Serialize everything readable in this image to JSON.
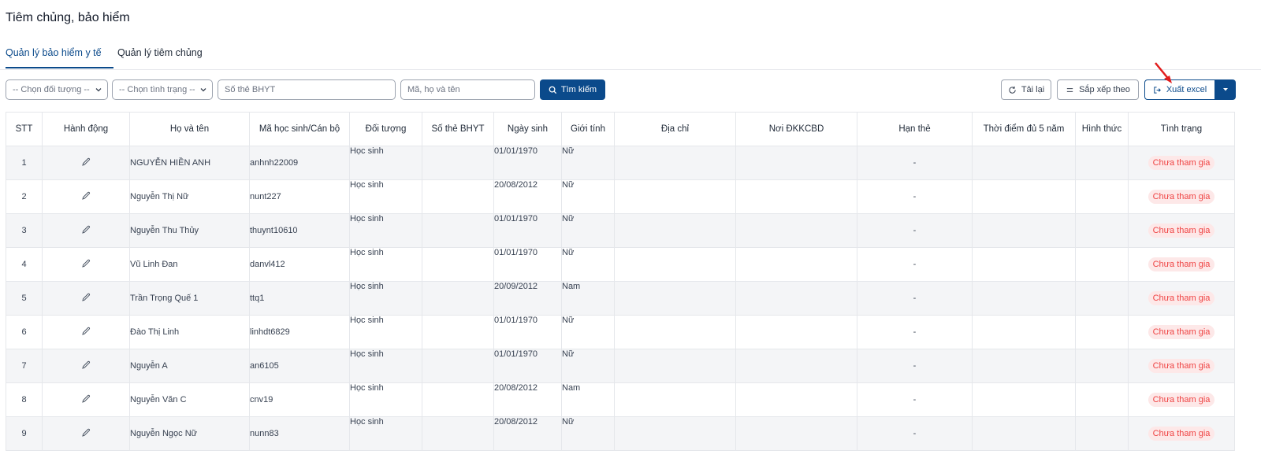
{
  "page": {
    "title": "Tiêm chủng, bảo hiểm"
  },
  "tabs": [
    {
      "label": "Quản lý bảo hiểm y tế",
      "active": true
    },
    {
      "label": "Quản lý tiêm chủng",
      "active": false
    }
  ],
  "filters": {
    "subject_select": "-- Chọn đối tượng --",
    "status_select": "-- Chọn tình trạng --",
    "card_placeholder": "Số thẻ BHYT",
    "name_placeholder": "Mã, họ và tên",
    "search_label": "Tìm kiếm"
  },
  "toolbar": {
    "reload_label": "Tải lại",
    "sort_label": "Sắp xếp theo",
    "export_label": "Xuất excel"
  },
  "colors": {
    "primary": "#0b4a8b",
    "status_text": "#ef4444",
    "status_bg": "#fde8e8",
    "arrow": "#e11d1d"
  },
  "table": {
    "headers": [
      "STT",
      "Hành động",
      "Họ và tên",
      "Mã học sinh/Cán bộ",
      "Đối tượng",
      "Số thẻ BHYT",
      "Ngày sinh",
      "Giới tính",
      "Địa chỉ",
      "Nơi ĐKKCBD",
      "Hạn thẻ",
      "Thời điểm đủ 5 năm",
      "Hình thức",
      "Tình trạng"
    ],
    "rows": [
      {
        "stt": "1",
        "name": "NGUYỄN HIỀN ANH",
        "code": "anhnh22009",
        "subject": "Học sinh",
        "card": "",
        "dob": "01/01/1970",
        "gender": "Nữ",
        "address": "",
        "place": "",
        "expiry": "-",
        "five_years": "",
        "form": "",
        "status": "Chưa tham gia"
      },
      {
        "stt": "2",
        "name": "Nguyễn Thị Nữ",
        "code": "nunt227",
        "subject": "Học sinh",
        "card": "",
        "dob": "20/08/2012",
        "gender": "Nữ",
        "address": "",
        "place": "",
        "expiry": "-",
        "five_years": "",
        "form": "",
        "status": "Chưa tham gia"
      },
      {
        "stt": "3",
        "name": "Nguyễn Thu Thủy",
        "code": "thuynt10610",
        "subject": "Học sinh",
        "card": "",
        "dob": "01/01/1970",
        "gender": "Nữ",
        "address": "",
        "place": "",
        "expiry": "-",
        "five_years": "",
        "form": "",
        "status": "Chưa tham gia"
      },
      {
        "stt": "4",
        "name": "Vũ Linh Đan",
        "code": "danvl412",
        "subject": "Học sinh",
        "card": "",
        "dob": "01/01/1970",
        "gender": "Nữ",
        "address": "",
        "place": "",
        "expiry": "-",
        "five_years": "",
        "form": "",
        "status": "Chưa tham gia"
      },
      {
        "stt": "5",
        "name": "Trần Trọng Quế 1",
        "code": "ttq1",
        "subject": "Học sinh",
        "card": "",
        "dob": "20/09/2012",
        "gender": "Nam",
        "address": "",
        "place": "",
        "expiry": "-",
        "five_years": "",
        "form": "",
        "status": "Chưa tham gia"
      },
      {
        "stt": "6",
        "name": "Đào Thị Linh",
        "code": "linhdt6829",
        "subject": "Học sinh",
        "card": "",
        "dob": "01/01/1970",
        "gender": "Nữ",
        "address": "",
        "place": "",
        "expiry": "-",
        "five_years": "",
        "form": "",
        "status": "Chưa tham gia"
      },
      {
        "stt": "7",
        "name": "Nguyễn A",
        "code": "an6105",
        "subject": "Học sinh",
        "card": "",
        "dob": "01/01/1970",
        "gender": "Nữ",
        "address": "",
        "place": "",
        "expiry": "-",
        "five_years": "",
        "form": "",
        "status": "Chưa tham gia"
      },
      {
        "stt": "8",
        "name": "Nguyễn Văn C",
        "code": "cnv19",
        "subject": "Học sinh",
        "card": "",
        "dob": "20/08/2012",
        "gender": "Nam",
        "address": "",
        "place": "",
        "expiry": "-",
        "five_years": "",
        "form": "",
        "status": "Chưa tham gia"
      },
      {
        "stt": "9",
        "name": "Nguyễn Ngọc Nữ",
        "code": "nunn83",
        "subject": "Học sinh",
        "card": "",
        "dob": "20/08/2012",
        "gender": "Nữ",
        "address": "",
        "place": "",
        "expiry": "-",
        "five_years": "",
        "form": "",
        "status": "Chưa tham gia"
      }
    ]
  }
}
